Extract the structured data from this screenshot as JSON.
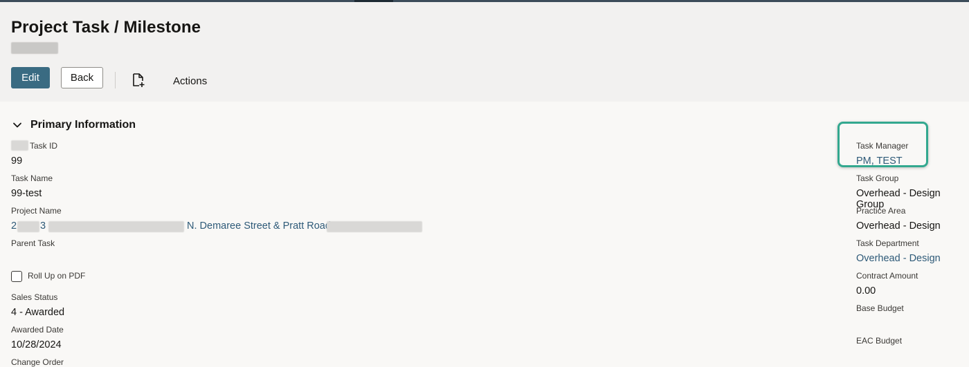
{
  "page": {
    "title": "Project Task / Milestone"
  },
  "toolbar": {
    "edit_label": "Edit",
    "back_label": "Back",
    "new_document_icon": "file-plus-icon",
    "actions_label": "Actions"
  },
  "section": {
    "title": "Primary Information",
    "toggle_icon": "chevron-down-icon"
  },
  "left_fields": {
    "task_id": {
      "label": "Task ID",
      "value": "99"
    },
    "task_name": {
      "label": "Task Name",
      "value": "99-test"
    },
    "project_name": {
      "label": "Project Name",
      "value_start": "2",
      "value_mid": "3",
      "value_visible": "N. Demaree Street & Pratt Road"
    },
    "parent_task": {
      "label": "Parent Task"
    },
    "roll_up_on_pdf": {
      "label": "Roll Up on PDF",
      "checked": false
    },
    "sales_status": {
      "label": "Sales Status",
      "value": "4 - Awarded"
    },
    "awarded_date": {
      "label": "Awarded Date",
      "value": "10/28/2024"
    },
    "change_order": {
      "label": "Change Order"
    }
  },
  "right_fields": {
    "task_manager": {
      "label": "Task Manager",
      "value": "PM, TEST"
    },
    "task_group": {
      "label": "Task Group",
      "value": "Overhead - Design Group"
    },
    "practice_area": {
      "label": "Practice Area",
      "value": "Overhead - Design"
    },
    "task_department": {
      "label": "Task Department",
      "value": "Overhead - Design"
    },
    "contract_amount": {
      "label": "Contract Amount",
      "value": "0.00"
    },
    "base_budget": {
      "label": "Base Budget"
    },
    "eac_budget": {
      "label": "EAC Budget"
    }
  },
  "colors": {
    "primary_button": "#3a6b82",
    "link": "#2e5a78",
    "highlight": "#33a88f"
  }
}
